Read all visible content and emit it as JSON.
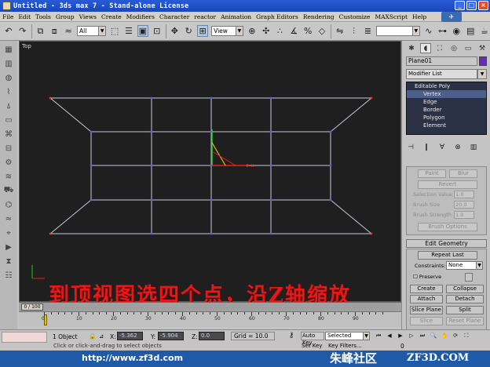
{
  "window": {
    "title": "Untitled - 3ds max 7 - Stand-alone License"
  },
  "menu": [
    "File",
    "Edit",
    "Tools",
    "Group",
    "Views",
    "Create",
    "Modifiers",
    "Character",
    "reactor",
    "Animation",
    "Graph Editors",
    "Rendering",
    "Customize",
    "MAXScript",
    "Help"
  ],
  "toolbar": {
    "selection_filter": "All",
    "reference_coord": "View"
  },
  "viewport": {
    "label": "Top"
  },
  "overlay_caption": "到顶视图选四个点，沿Z轴缩放",
  "command_panel": {
    "object_name": "Plane01",
    "object_color": "#6a2ab8",
    "modifier_list": "Modifier List",
    "stack": {
      "root": "Editable Poly",
      "items": [
        "Vertex",
        "Edge",
        "Border",
        "Polygon",
        "Element"
      ],
      "selected": "Vertex"
    },
    "soft_selection": {
      "paint_label": "Paint",
      "blur_label": "Blur",
      "revert_label": "Revert",
      "selection_value_label": "Selection Value",
      "selection_value": "1.0",
      "brush_size_label": "Brush Size",
      "brush_size": "20.0",
      "brush_strength_label": "Brush Strength",
      "brush_strength": "1.0",
      "brush_options_label": "Brush Options"
    },
    "edit_geometry": {
      "title": "Edit Geometry",
      "repeat_last": "Repeat Last",
      "constraints_label": "Constraints:",
      "constraints_value": "None",
      "preserve_label": "Preserve",
      "create_label": "Create",
      "collapse_label": "Collapse",
      "attach_label": "Attach",
      "detach_label": "Detach",
      "slice_plane_label": "Slice Plane",
      "split_label": "Split",
      "slice_label": "Slice",
      "reset_plane_label": "Reset Plane"
    }
  },
  "timeline": {
    "slider_label": "0 / 100",
    "ticks": [
      "0",
      "10",
      "20",
      "30",
      "40",
      "50",
      "60",
      "70",
      "80",
      "90"
    ]
  },
  "status": {
    "objects": "1 Object",
    "x_label": "X:",
    "x_value": "-5.362",
    "y_label": "Y:",
    "y_value": "-5.904",
    "z_label": "Z:",
    "z_value": "0.0",
    "grid": "Grid = 10.0",
    "auto_key": "Auto Key",
    "selected": "Selected",
    "set_key": "Set Key",
    "key_filters": "Key Filters...",
    "hint": "Click or click-and-drag to select objects",
    "frame": "0"
  },
  "watermark": {
    "url": "http://www.zf3d.com",
    "brand_cn": "朱峰社区",
    "brand_en": "ZF3D.COM"
  },
  "mesh_colors": {
    "wire": "#c8c8d8",
    "vertex": "#5a5aff",
    "selected_vertex": "#ff3030"
  }
}
